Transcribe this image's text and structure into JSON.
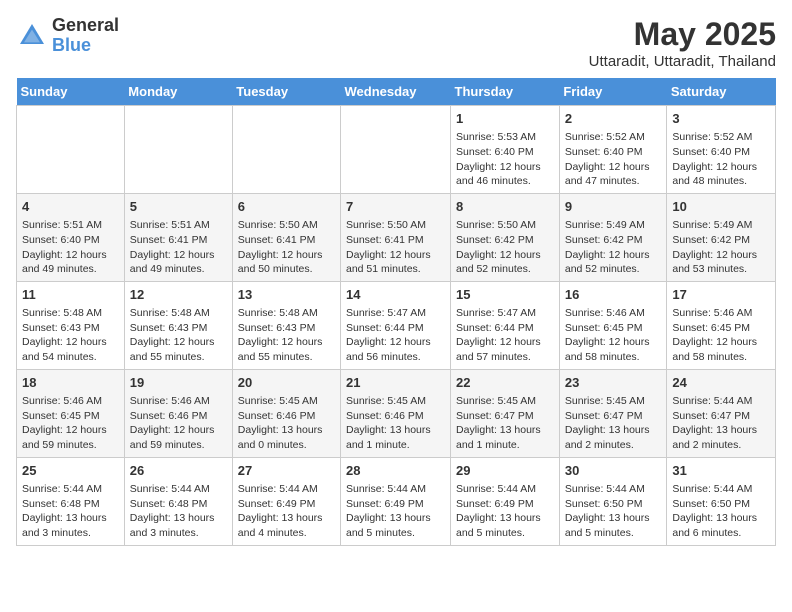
{
  "header": {
    "logo_general": "General",
    "logo_blue": "Blue",
    "month_title": "May 2025",
    "location": "Uttaradit, Uttaradit, Thailand"
  },
  "days_of_week": [
    "Sunday",
    "Monday",
    "Tuesday",
    "Wednesday",
    "Thursday",
    "Friday",
    "Saturday"
  ],
  "weeks": [
    [
      {
        "num": "",
        "info": ""
      },
      {
        "num": "",
        "info": ""
      },
      {
        "num": "",
        "info": ""
      },
      {
        "num": "",
        "info": ""
      },
      {
        "num": "1",
        "info": "Sunrise: 5:53 AM\nSunset: 6:40 PM\nDaylight: 12 hours and 46 minutes."
      },
      {
        "num": "2",
        "info": "Sunrise: 5:52 AM\nSunset: 6:40 PM\nDaylight: 12 hours and 47 minutes."
      },
      {
        "num": "3",
        "info": "Sunrise: 5:52 AM\nSunset: 6:40 PM\nDaylight: 12 hours and 48 minutes."
      }
    ],
    [
      {
        "num": "4",
        "info": "Sunrise: 5:51 AM\nSunset: 6:40 PM\nDaylight: 12 hours and 49 minutes."
      },
      {
        "num": "5",
        "info": "Sunrise: 5:51 AM\nSunset: 6:41 PM\nDaylight: 12 hours and 49 minutes."
      },
      {
        "num": "6",
        "info": "Sunrise: 5:50 AM\nSunset: 6:41 PM\nDaylight: 12 hours and 50 minutes."
      },
      {
        "num": "7",
        "info": "Sunrise: 5:50 AM\nSunset: 6:41 PM\nDaylight: 12 hours and 51 minutes."
      },
      {
        "num": "8",
        "info": "Sunrise: 5:50 AM\nSunset: 6:42 PM\nDaylight: 12 hours and 52 minutes."
      },
      {
        "num": "9",
        "info": "Sunrise: 5:49 AM\nSunset: 6:42 PM\nDaylight: 12 hours and 52 minutes."
      },
      {
        "num": "10",
        "info": "Sunrise: 5:49 AM\nSunset: 6:42 PM\nDaylight: 12 hours and 53 minutes."
      }
    ],
    [
      {
        "num": "11",
        "info": "Sunrise: 5:48 AM\nSunset: 6:43 PM\nDaylight: 12 hours and 54 minutes."
      },
      {
        "num": "12",
        "info": "Sunrise: 5:48 AM\nSunset: 6:43 PM\nDaylight: 12 hours and 55 minutes."
      },
      {
        "num": "13",
        "info": "Sunrise: 5:48 AM\nSunset: 6:43 PM\nDaylight: 12 hours and 55 minutes."
      },
      {
        "num": "14",
        "info": "Sunrise: 5:47 AM\nSunset: 6:44 PM\nDaylight: 12 hours and 56 minutes."
      },
      {
        "num": "15",
        "info": "Sunrise: 5:47 AM\nSunset: 6:44 PM\nDaylight: 12 hours and 57 minutes."
      },
      {
        "num": "16",
        "info": "Sunrise: 5:46 AM\nSunset: 6:45 PM\nDaylight: 12 hours and 58 minutes."
      },
      {
        "num": "17",
        "info": "Sunrise: 5:46 AM\nSunset: 6:45 PM\nDaylight: 12 hours and 58 minutes."
      }
    ],
    [
      {
        "num": "18",
        "info": "Sunrise: 5:46 AM\nSunset: 6:45 PM\nDaylight: 12 hours and 59 minutes."
      },
      {
        "num": "19",
        "info": "Sunrise: 5:46 AM\nSunset: 6:46 PM\nDaylight: 12 hours and 59 minutes."
      },
      {
        "num": "20",
        "info": "Sunrise: 5:45 AM\nSunset: 6:46 PM\nDaylight: 13 hours and 0 minutes."
      },
      {
        "num": "21",
        "info": "Sunrise: 5:45 AM\nSunset: 6:46 PM\nDaylight: 13 hours and 1 minute."
      },
      {
        "num": "22",
        "info": "Sunrise: 5:45 AM\nSunset: 6:47 PM\nDaylight: 13 hours and 1 minute."
      },
      {
        "num": "23",
        "info": "Sunrise: 5:45 AM\nSunset: 6:47 PM\nDaylight: 13 hours and 2 minutes."
      },
      {
        "num": "24",
        "info": "Sunrise: 5:44 AM\nSunset: 6:47 PM\nDaylight: 13 hours and 2 minutes."
      }
    ],
    [
      {
        "num": "25",
        "info": "Sunrise: 5:44 AM\nSunset: 6:48 PM\nDaylight: 13 hours and 3 minutes."
      },
      {
        "num": "26",
        "info": "Sunrise: 5:44 AM\nSunset: 6:48 PM\nDaylight: 13 hours and 3 minutes."
      },
      {
        "num": "27",
        "info": "Sunrise: 5:44 AM\nSunset: 6:49 PM\nDaylight: 13 hours and 4 minutes."
      },
      {
        "num": "28",
        "info": "Sunrise: 5:44 AM\nSunset: 6:49 PM\nDaylight: 13 hours and 5 minutes."
      },
      {
        "num": "29",
        "info": "Sunrise: 5:44 AM\nSunset: 6:49 PM\nDaylight: 13 hours and 5 minutes."
      },
      {
        "num": "30",
        "info": "Sunrise: 5:44 AM\nSunset: 6:50 PM\nDaylight: 13 hours and 5 minutes."
      },
      {
        "num": "31",
        "info": "Sunrise: 5:44 AM\nSunset: 6:50 PM\nDaylight: 13 hours and 6 minutes."
      }
    ]
  ]
}
